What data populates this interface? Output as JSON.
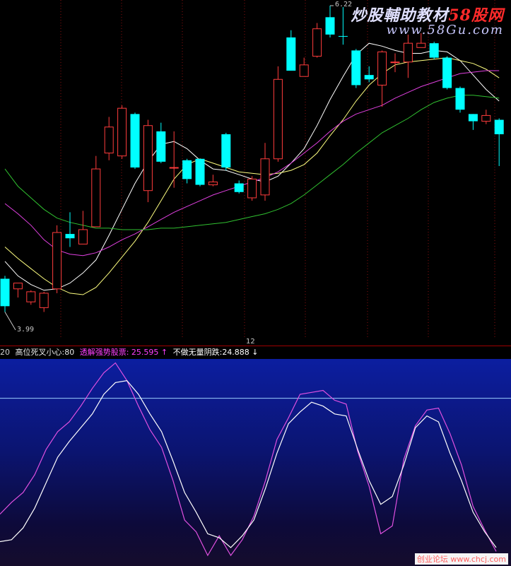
{
  "chart_data": [
    {
      "type": "candlestick",
      "price_labels": {
        "high": "6.22",
        "low": "3.99"
      },
      "candles": [
        {
          "o": 4.33,
          "h": 4.35,
          "l": 4.1,
          "c": 4.14,
          "color": "cyan"
        },
        {
          "o": 4.26,
          "h": 4.3,
          "l": 4.2,
          "c": 4.3,
          "color": "red"
        },
        {
          "o": 4.17,
          "h": 4.25,
          "l": 4.15,
          "c": 4.24,
          "color": "red"
        },
        {
          "o": 4.13,
          "h": 4.24,
          "l": 4.1,
          "c": 4.23,
          "color": "red"
        },
        {
          "o": 4.26,
          "h": 4.7,
          "l": 4.23,
          "c": 4.65,
          "color": "red"
        },
        {
          "o": 4.64,
          "h": 4.79,
          "l": 4.55,
          "c": 4.61,
          "color": "cyan"
        },
        {
          "o": 4.57,
          "h": 4.8,
          "l": 4.57,
          "c": 4.67,
          "color": "red"
        },
        {
          "o": 4.69,
          "h": 5.18,
          "l": 4.69,
          "c": 5.09,
          "color": "red"
        },
        {
          "o": 5.2,
          "h": 5.45,
          "l": 5.15,
          "c": 5.38,
          "color": "red"
        },
        {
          "o": 5.18,
          "h": 5.53,
          "l": 5.16,
          "c": 5.51,
          "color": "red"
        },
        {
          "o": 5.47,
          "h": 5.48,
          "l": 5.09,
          "c": 5.1,
          "color": "cyan"
        },
        {
          "o": 4.94,
          "h": 5.43,
          "l": 4.86,
          "c": 5.39,
          "color": "red"
        },
        {
          "o": 5.35,
          "h": 5.41,
          "l": 5.13,
          "c": 5.14,
          "color": "cyan"
        },
        {
          "o": 5.1,
          "h": 5.35,
          "l": 4.96,
          "c": 5.1,
          "color": "red"
        },
        {
          "o": 5.15,
          "h": 5.16,
          "l": 4.99,
          "c": 5.02,
          "color": "cyan"
        },
        {
          "o": 5.16,
          "h": 5.16,
          "l": 4.97,
          "c": 4.98,
          "color": "cyan"
        },
        {
          "o": 4.98,
          "h": 5.05,
          "l": 4.97,
          "c": 5.0,
          "color": "red"
        },
        {
          "o": 5.33,
          "h": 5.34,
          "l": 5.08,
          "c": 5.1,
          "color": "cyan"
        },
        {
          "o": 4.99,
          "h": 5.01,
          "l": 4.92,
          "c": 4.93,
          "color": "cyan"
        },
        {
          "o": 4.89,
          "h": 5.04,
          "l": 4.87,
          "c": 5.02,
          "color": "red"
        },
        {
          "o": 4.91,
          "h": 5.27,
          "l": 4.87,
          "c": 5.16,
          "color": "red"
        },
        {
          "o": 5.16,
          "h": 5.8,
          "l": 5.14,
          "c": 5.71,
          "color": "red"
        },
        {
          "o": 5.77,
          "h": 6.05,
          "l": 5.77,
          "c": 6.0,
          "color": "cyan"
        },
        {
          "o": 5.73,
          "h": 5.86,
          "l": 5.73,
          "c": 5.81,
          "color": "red"
        },
        {
          "o": 5.87,
          "h": 6.1,
          "l": 5.86,
          "c": 6.06,
          "color": "red"
        },
        {
          "o": 6.14,
          "h": 6.22,
          "l": 6.0,
          "c": 6.02,
          "color": "cyan"
        },
        {
          "o": 6.01,
          "h": 6.21,
          "l": 5.95,
          "c": 6.01,
          "color": "cyan"
        },
        {
          "o": 5.91,
          "h": 5.92,
          "l": 5.65,
          "c": 5.67,
          "color": "cyan"
        },
        {
          "o": 5.71,
          "h": 5.8,
          "l": 5.69,
          "c": 5.74,
          "color": "cyan"
        },
        {
          "o": 5.67,
          "h": 5.91,
          "l": 5.52,
          "c": 5.9,
          "color": "red"
        },
        {
          "o": 5.83,
          "h": 5.89,
          "l": 5.76,
          "c": 5.83,
          "color": "red"
        },
        {
          "o": 5.83,
          "h": 6.02,
          "l": 5.72,
          "c": 5.96,
          "color": "red"
        },
        {
          "o": 5.96,
          "h": 6.03,
          "l": 5.93,
          "c": 5.93,
          "color": "red"
        },
        {
          "o": 5.96,
          "h": 5.97,
          "l": 5.85,
          "c": 5.86,
          "color": "cyan"
        },
        {
          "o": 5.86,
          "h": 5.87,
          "l": 5.64,
          "c": 5.65,
          "color": "cyan"
        },
        {
          "o": 5.65,
          "h": 5.66,
          "l": 5.48,
          "c": 5.5,
          "color": "cyan"
        },
        {
          "o": 5.47,
          "h": 5.47,
          "l": 5.36,
          "c": 5.42,
          "color": "cyan"
        },
        {
          "o": 5.42,
          "h": 5.5,
          "l": 5.4,
          "c": 5.46,
          "color": "red"
        },
        {
          "o": 5.43,
          "h": 5.44,
          "l": 5.11,
          "c": 5.33,
          "color": "cyan"
        }
      ],
      "ma_series": [
        {
          "color": "#ffffff",
          "values": [
            4.45,
            4.35,
            4.29,
            4.25,
            4.26,
            4.3,
            4.37,
            4.46,
            4.63,
            4.81,
            4.99,
            5.14,
            5.26,
            5.28,
            5.23,
            5.15,
            5.09,
            5.08,
            5.05,
            5.02,
            5.0,
            5.04,
            5.13,
            5.23,
            5.39,
            5.57,
            5.73,
            5.88,
            5.96,
            5.94,
            5.91,
            5.89,
            5.89,
            5.91,
            5.9,
            5.84,
            5.74,
            5.64,
            5.56
          ]
        },
        {
          "color": "#ffff80",
          "values": [
            4.55,
            4.47,
            4.4,
            4.33,
            4.27,
            4.23,
            4.22,
            4.27,
            4.37,
            4.48,
            4.59,
            4.72,
            4.87,
            5.02,
            5.12,
            5.16,
            5.13,
            5.1,
            5.07,
            5.06,
            5.05,
            5.06,
            5.08,
            5.12,
            5.2,
            5.32,
            5.43,
            5.56,
            5.67,
            5.75,
            5.81,
            5.83,
            5.84,
            5.85,
            5.86,
            5.84,
            5.82,
            5.78,
            5.72
          ]
        },
        {
          "color": "#e040e0",
          "values": [
            4.85,
            4.78,
            4.7,
            4.6,
            4.53,
            4.5,
            4.49,
            4.51,
            4.55,
            4.6,
            4.64,
            4.69,
            4.74,
            4.79,
            4.83,
            4.87,
            4.91,
            4.94,
            4.97,
            5.0,
            5.03,
            5.07,
            5.13,
            5.2,
            5.27,
            5.35,
            5.42,
            5.47,
            5.5,
            5.53,
            5.58,
            5.62,
            5.66,
            5.69,
            5.72,
            5.75,
            5.76,
            5.77,
            5.77
          ]
        },
        {
          "color": "#30c030",
          "values": [
            5.09,
            4.97,
            4.89,
            4.81,
            4.75,
            4.72,
            4.7,
            4.68,
            4.68,
            4.67,
            4.67,
            4.67,
            4.68,
            4.68,
            4.69,
            4.7,
            4.71,
            4.72,
            4.74,
            4.76,
            4.78,
            4.81,
            4.85,
            4.91,
            4.98,
            5.05,
            5.12,
            5.2,
            5.27,
            5.34,
            5.39,
            5.44,
            5.5,
            5.55,
            5.58,
            5.6,
            5.6,
            5.59,
            5.58
          ]
        }
      ]
    },
    {
      "type": "line",
      "header_items": [
        {
          "text": "20",
          "color": "#d0d0d0"
        },
        {
          "text": "高位死叉小心:80",
          "color": "#e8e8e8"
        },
        {
          "text": "透解强势股票: 25.595 ↑",
          "color": "#ff40ff"
        },
        {
          "text": "不做无量阴跌:24.888 ↓",
          "color": "#ffffff"
        }
      ],
      "ylim": [
        0,
        100
      ],
      "reference_line": 80,
      "series": [
        {
          "color": "#e050e0",
          "values": [
            21,
            27,
            32,
            41,
            54,
            63,
            68,
            76,
            85,
            93,
            98,
            89,
            76,
            64,
            55,
            38,
            18,
            12,
            0,
            10,
            0,
            8,
            20,
            38,
            59,
            70,
            82,
            83,
            84,
            79,
            77,
            53,
            35,
            11,
            15,
            49,
            66,
            74,
            75,
            62,
            46,
            25,
            13,
            2
          ]
        },
        {
          "color": "#ffffff",
          "values": [
            7,
            8,
            14,
            24,
            37,
            50,
            58,
            65,
            72,
            82,
            88,
            89,
            82,
            72,
            63,
            48,
            32,
            22,
            11,
            9,
            4,
            10,
            18,
            34,
            52,
            67,
            73,
            78,
            76,
            72,
            71,
            54,
            38,
            26,
            30,
            46,
            65,
            71,
            68,
            52,
            38,
            22,
            12,
            4
          ]
        }
      ]
    }
  ],
  "x_axis": {
    "tick_label": "12"
  },
  "watermark": {
    "line1_main": "炒股輔助教材",
    "line1_accent": "58股网",
    "line2": "www.58Gu.com",
    "footer": "创业论坛 www.chcj.com"
  }
}
